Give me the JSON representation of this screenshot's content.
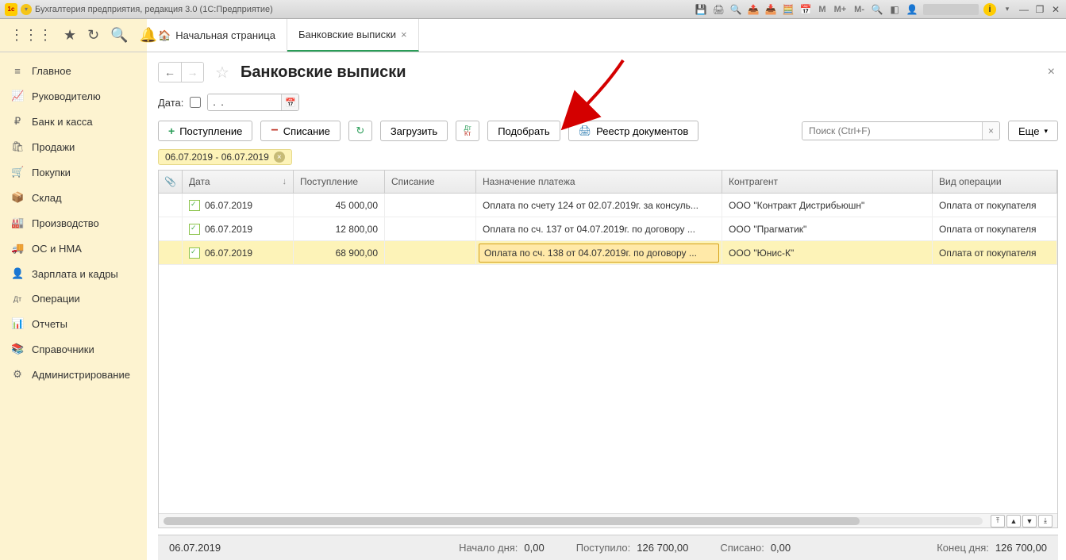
{
  "app": {
    "title": "Бухгалтерия предприятия, редакция 3.0  (1С:Предприятие)"
  },
  "tabs": {
    "home": "Начальная страница",
    "active": "Банковские выписки"
  },
  "sidebar": {
    "items": [
      {
        "icon": "≡",
        "label": "Главное"
      },
      {
        "icon": "📈",
        "label": "Руководителю"
      },
      {
        "icon": "₽",
        "label": "Банк и касса"
      },
      {
        "icon": "🛍",
        "label": "Продажи"
      },
      {
        "icon": "🛒",
        "label": "Покупки"
      },
      {
        "icon": "📦",
        "label": "Склад"
      },
      {
        "icon": "🏭",
        "label": "Производство"
      },
      {
        "icon": "🚚",
        "label": "ОС и НМА"
      },
      {
        "icon": "👤",
        "label": "Зарплата и кадры"
      },
      {
        "icon": "Дт",
        "label": "Операции"
      },
      {
        "icon": "📊",
        "label": "Отчеты"
      },
      {
        "icon": "📚",
        "label": "Справочники"
      },
      {
        "icon": "⚙",
        "label": "Администрирование"
      }
    ]
  },
  "page": {
    "title": "Банковские выписки",
    "date_label": "Дата:",
    "date_value": ".  .",
    "toolbar": {
      "income": "Поступление",
      "expense": "Списание",
      "load": "Загрузить",
      "pick": "Подобрать",
      "registry": "Реестр документов",
      "search_placeholder": "Поиск (Ctrl+F)",
      "more": "Еще"
    },
    "filter_chip": "06.07.2019 - 06.07.2019",
    "columns": {
      "date": "Дата",
      "in": "Поступление",
      "out": "Списание",
      "purpose": "Назначение платежа",
      "contr": "Контрагент",
      "type": "Вид операции"
    },
    "rows": [
      {
        "date": "06.07.2019",
        "in": "45 000,00",
        "out": "",
        "purpose": "Оплата по счету 124 от 02.07.2019г. за консуль...",
        "contr": "ООО \"Контракт Дистрибьюшн\"",
        "type": "Оплата от покупателя"
      },
      {
        "date": "06.07.2019",
        "in": "12 800,00",
        "out": "",
        "purpose": "Оплата по сч. 137 от 04.07.2019г. по договору ...",
        "contr": "ООО \"Прагматик\"",
        "type": "Оплата от покупателя"
      },
      {
        "date": "06.07.2019",
        "in": "68 900,00",
        "out": "",
        "purpose": "Оплата по сч. 138 от 04.07.2019г. по договору ...",
        "contr": "ООО \"Юнис-К\"",
        "type": "Оплата от покупателя"
      }
    ],
    "status": {
      "date": "06.07.2019",
      "start_lbl": "Начало дня:",
      "start_val": "0,00",
      "in_lbl": "Поступило:",
      "in_val": "126 700,00",
      "out_lbl": "Списано:",
      "out_val": "0,00",
      "end_lbl": "Конец дня:",
      "end_val": "126 700,00"
    }
  },
  "titlebar_m": {
    "m": "M",
    "mp": "M+",
    "mm": "M-"
  }
}
